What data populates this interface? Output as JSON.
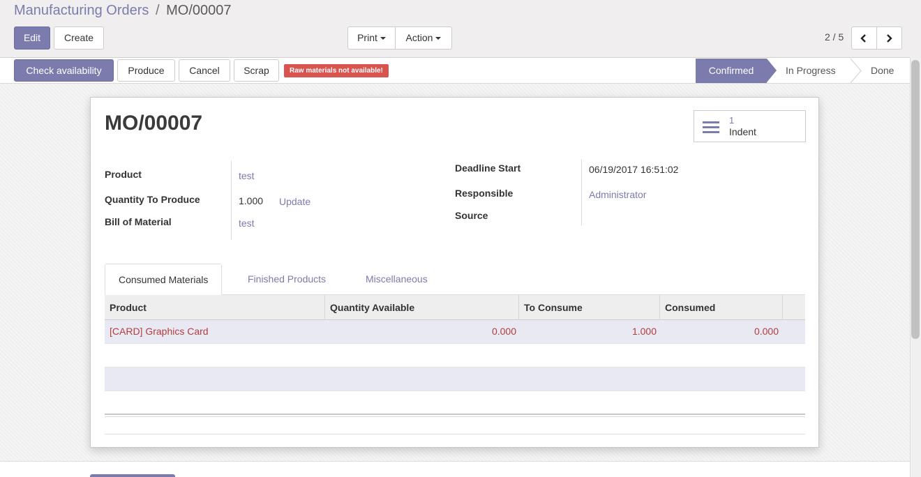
{
  "breadcrumb": {
    "parent": "Manufacturing Orders",
    "separator": "/",
    "current": "MO/00007"
  },
  "toolbar": {
    "edit_label": "Edit",
    "create_label": "Create",
    "print_label": "Print",
    "action_label": "Action"
  },
  "pager": {
    "value": "2 / 5"
  },
  "statusbar": {
    "buttons": {
      "check": "Check availability",
      "produce": "Produce",
      "cancel": "Cancel",
      "scrap": "Scrap"
    },
    "warning": "Raw materials not available!",
    "stages": {
      "confirmed": "Confirmed",
      "in_progress": "In Progress",
      "done": "Done"
    },
    "active_stage": "Confirmed"
  },
  "record": {
    "title": "MO/00007",
    "smart_button": {
      "count": "1",
      "label": "Indent",
      "icon": "list-icon"
    },
    "left_fields": {
      "product_label": "Product",
      "product_value": "test",
      "qty_label": "Quantity To Produce",
      "qty_value": "1.000",
      "qty_update": "Update",
      "bom_label": "Bill of Material",
      "bom_value": "test"
    },
    "right_fields": {
      "deadline_label": "Deadline Start",
      "deadline_value": "06/19/2017 16:51:02",
      "responsible_label": "Responsible",
      "responsible_value": "Administrator",
      "source_label": "Source"
    }
  },
  "tabs": {
    "consumed": "Consumed Materials",
    "finished": "Finished Products",
    "misc": "Miscellaneous"
  },
  "table": {
    "columns": {
      "product": "Product",
      "qty_available": "Quantity Available",
      "to_consume": "To Consume",
      "consumed": "Consumed"
    },
    "rows": [
      {
        "product": "[CARD] Graphics Card",
        "qty_available": "0.000",
        "to_consume": "1.000",
        "consumed": "0.000"
      }
    ]
  },
  "colors": {
    "accent": "#7c7bad",
    "warning": "#d9534f",
    "row_unavailable": "#b33c3c"
  }
}
